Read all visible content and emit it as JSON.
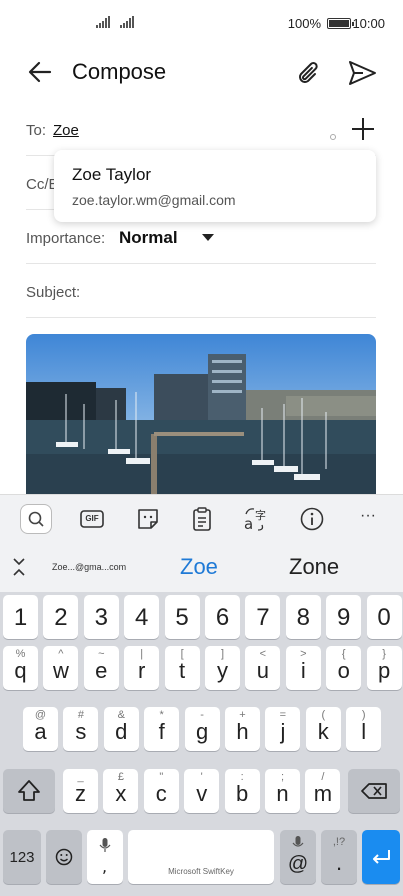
{
  "status": {
    "battery": "100%",
    "time": "10:00"
  },
  "header": {
    "title": "Compose"
  },
  "to": {
    "label": "To:",
    "value": "Zoe"
  },
  "cc": {
    "label": "Cc/B"
  },
  "importance": {
    "label": "Importance:",
    "value": "Normal"
  },
  "subject": {
    "label": "Subject:"
  },
  "suggestion": {
    "name": "Zoe Taylor",
    "email": "zoe.taylor.wm@gmail.com"
  },
  "toolbar": {
    "gif": "GIF",
    "more": "···"
  },
  "predictions": [
    "Zoe...@gma...com",
    "Zoe",
    "Zone"
  ],
  "keyboard": {
    "numbers": [
      "1",
      "2",
      "3",
      "4",
      "5",
      "6",
      "7",
      "8",
      "9",
      "0"
    ],
    "row1": [
      {
        "key": "q",
        "hint": "%"
      },
      {
        "key": "w",
        "hint": "^"
      },
      {
        "key": "e",
        "hint": "~"
      },
      {
        "key": "r",
        "hint": "|"
      },
      {
        "key": "t",
        "hint": "["
      },
      {
        "key": "y",
        "hint": "]"
      },
      {
        "key": "u",
        "hint": "<"
      },
      {
        "key": "i",
        "hint": ">"
      },
      {
        "key": "o",
        "hint": "{"
      },
      {
        "key": "p",
        "hint": "}"
      }
    ],
    "row2": [
      {
        "key": "a",
        "hint": "@"
      },
      {
        "key": "s",
        "hint": "#"
      },
      {
        "key": "d",
        "hint": "&"
      },
      {
        "key": "f",
        "hint": "*"
      },
      {
        "key": "g",
        "hint": "-"
      },
      {
        "key": "h",
        "hint": "+"
      },
      {
        "key": "j",
        "hint": "="
      },
      {
        "key": "k",
        "hint": "("
      },
      {
        "key": "l",
        "hint": ")"
      }
    ],
    "row3": [
      {
        "key": "z",
        "hint": "_"
      },
      {
        "key": "x",
        "hint": "£"
      },
      {
        "key": "c",
        "hint": "\""
      },
      {
        "key": "v",
        "hint": "'"
      },
      {
        "key": "b",
        "hint": ":"
      },
      {
        "key": "n",
        "hint": ";"
      },
      {
        "key": "m",
        "hint": "/"
      }
    ],
    "num_toggle": "123",
    "space_label": "Microsoft SwiftKey",
    "at": "@",
    "period": ".",
    "period_hint": ",!?"
  },
  "colors": {
    "accent": "#1a8cf0",
    "prediction": "#1f7ad6",
    "keyboard_bg": "#d7d9de"
  }
}
